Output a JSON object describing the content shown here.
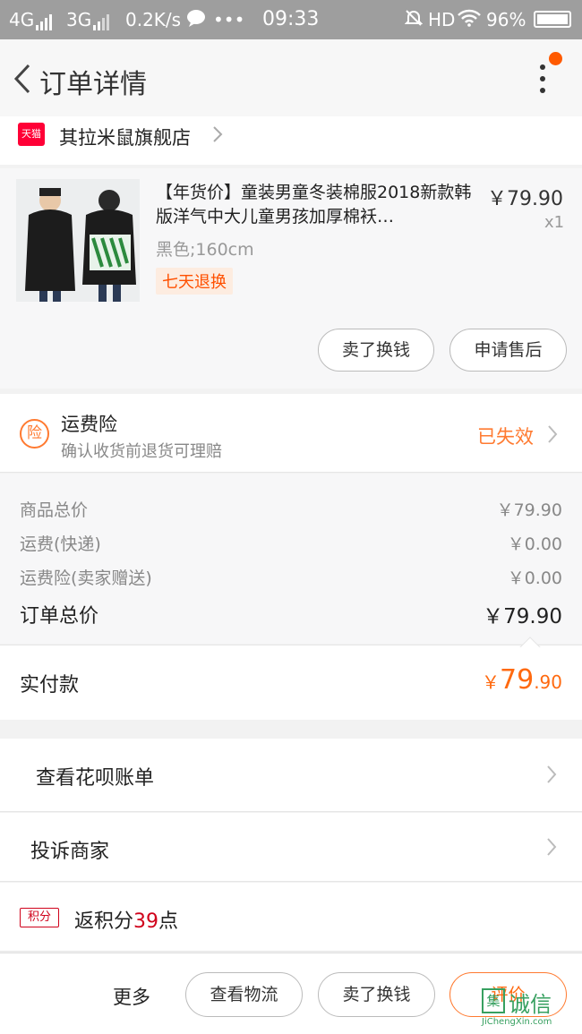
{
  "status_bar": {
    "network1": "4G",
    "network2": "3G",
    "speed": "0.2K/s",
    "dots": "•••",
    "time": "09:33",
    "hd": "HD",
    "battery": "96%"
  },
  "nav": {
    "title": "订单详情"
  },
  "store": {
    "platform_badge": "天猫",
    "name": "其拉米鼠旗舰店"
  },
  "product": {
    "title": "【年货价】童装男童冬装棉服2018新款韩版洋气中大儿童男孩加厚棉袄…",
    "price": "￥79.90",
    "qty": "x1",
    "sku": "黑色;160cm",
    "tag": "七天退换",
    "btn_sell": "卖了换钱",
    "btn_aftersale": "申请售后"
  },
  "insurance": {
    "icon_text": "险",
    "title": "运费险",
    "subtitle": "确认收货前退货可理赔",
    "status": "已失效"
  },
  "summary": {
    "rows": [
      {
        "label": "商品总价",
        "value": "￥79.90"
      },
      {
        "label": "运费(快递)",
        "value": "￥0.00"
      },
      {
        "label": "运费险(卖家赠送)",
        "value": "￥0.00"
      }
    ],
    "total_label": "订单总价",
    "total_value": "￥79.90"
  },
  "paid": {
    "label": "实付款",
    "currency": "￥",
    "integer": "79",
    "decimal": ".90"
  },
  "links": {
    "huabei": "查看花呗账单",
    "complain": "投诉商家",
    "points_badge": "积分",
    "points_prefix": "返积分",
    "points_num": "39",
    "points_suffix": "点"
  },
  "bottom": {
    "more": "更多",
    "btn_logistics": "查看物流",
    "btn_sell": "卖了换钱",
    "btn_review": "评价"
  },
  "watermark": {
    "logo": "集",
    "text": "诚信",
    "url": "JiChengXin.com"
  },
  "colors": {
    "accent": "#ff6a10",
    "tmall": "#ff0036",
    "points": "#d0021b"
  }
}
